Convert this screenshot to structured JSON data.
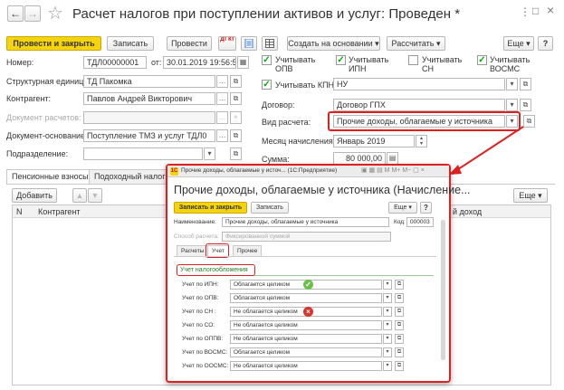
{
  "window": {
    "title": "Расчет налогов при поступлении активов и услуг: Проведен *",
    "nav_back": "←",
    "nav_forward": "→",
    "star": "☆",
    "more_menu": "⋮",
    "maximize": "□",
    "close": "×"
  },
  "toolbar": {
    "post_close": "Провести и закрыть",
    "save": "Записать",
    "post": "Провести",
    "dtkt": "Дт Кт",
    "create_based": "Создать на основании",
    "calculate": "Рассчитать",
    "more": "Еще",
    "help": "?"
  },
  "form": {
    "number_label": "Номер:",
    "number_value": "ТДЛ00000001",
    "from_label": "от:",
    "date_value": "30.01.2019 19:56:54",
    "unit_label": "Структурная единица:",
    "unit_value": "ТД Пакомка",
    "counterparty_label": "Контрагент:",
    "counterparty_value": "Павлов Андрей Викторович",
    "paydoc_label": "Документ расчетов:",
    "basedoc_label": "Документ-основание:",
    "basedoc_value": "Поступление ТМЗ и услуг ТДЛ0",
    "division_label": "Подразделение:",
    "chk_opv": "Учитывать ОПВ",
    "chk_ipn": "Учитывать ИПН",
    "chk_sn": "Учитывать СН",
    "chk_vosms": "Учитывать ВОСМС",
    "chk_kpn": "Учитывать КПН",
    "kpn_value": "НУ",
    "contract_label": "Договор:",
    "contract_value": "Договор ГПХ",
    "calc_type_label": "Вид расчета:",
    "calc_type_value": "Прочие доходы, облагаемые у источника",
    "month_label": "Месяц начисления:",
    "month_value": "Январь 2019",
    "sum_label": "Сумма:",
    "sum_value": "80 000,00"
  },
  "tabs": {
    "pension": "Пенсионные взносы",
    "income": "Подоходный налог",
    "add": "Добавить",
    "more": "Еще",
    "col_n": "N",
    "col_contractor": "Контрагент",
    "col_income": "й доход"
  },
  "popup": {
    "title": "Прочие доходы, облагаемые у источ...  (1С:Предприятие)",
    "heading": "Прочие доходы, облагаемые у источника (Начисление...",
    "save_close": "Записать и закрыть",
    "save": "Записать",
    "more": "Еще",
    "help": "?",
    "name_label": "Наименование:",
    "name_value": "Прочие доходы, облагаемые у источника",
    "code_label": "Код:",
    "code_value": "000003",
    "method_label": "Способ расчета:",
    "method_value": "Фиксированной суммой",
    "tab_calc": "Расчеты",
    "tab_account": "Учет",
    "tab_other": "Прочее",
    "section_title": "Учет налогообложения",
    "rows": [
      {
        "label": "Учет по ИПН:",
        "value": "Облагается целиком",
        "mark": "ok"
      },
      {
        "label": "Учет по ОПВ:",
        "value": "Облагается целиком",
        "mark": ""
      },
      {
        "label": "Учет по СН :",
        "value": "Не облагается целиком",
        "mark": "no"
      },
      {
        "label": "Учет по СО:",
        "value": "Не облагается целиком",
        "mark": ""
      },
      {
        "label": "Учет по ОППВ:",
        "value": "Не облагается целиком",
        "mark": ""
      },
      {
        "label": "Учет по ВОСМС:",
        "value": "Облагается целиком",
        "mark": ""
      },
      {
        "label": "Учет по ООСМС:",
        "value": "Не облагается целиком",
        "mark": ""
      }
    ]
  },
  "colors": {
    "accent_yellow": "#f5d40d",
    "highlight_red": "#e02020",
    "ok_green": "#6cc04a",
    "no_red": "#d9342b"
  }
}
